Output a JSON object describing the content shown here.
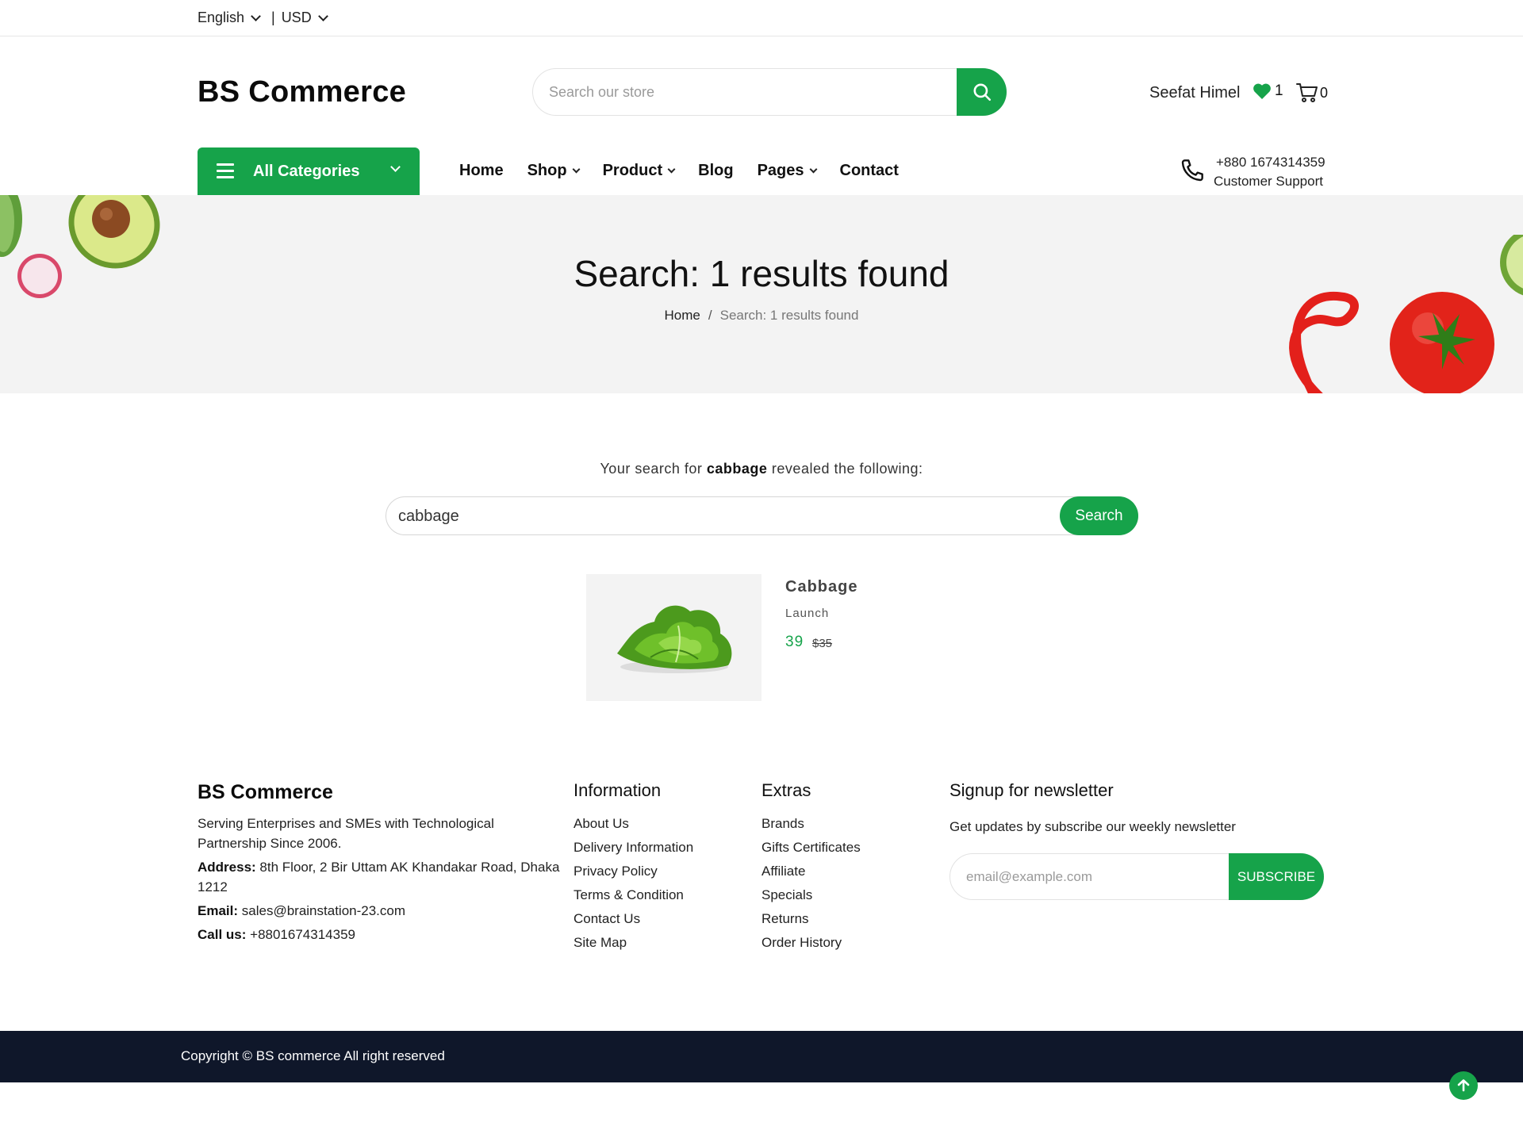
{
  "topbar": {
    "language": "English",
    "currency": "USD",
    "separator": "|"
  },
  "header": {
    "logo": "BS Commerce",
    "search_placeholder": "Search our store",
    "user_name": "Seefat Himel",
    "wishlist_count": "1",
    "cart_count": "0"
  },
  "nav": {
    "all_categories": "All Categories",
    "items": [
      "Home",
      "Shop",
      "Product",
      "Blog",
      "Pages",
      "Contact"
    ],
    "support_phone": "+880 1674314359",
    "support_label": "Customer Support"
  },
  "hero": {
    "title": "Search: 1 results found",
    "breadcrumb_home": "Home",
    "breadcrumb_sep": "/",
    "breadcrumb_current": "Search: 1 results found"
  },
  "results": {
    "reveal_prefix": "Your search for",
    "query": "cabbage",
    "reveal_suffix": "revealed the following:",
    "search_value": "cabbage",
    "search_button": "Search",
    "product": {
      "name": "Cabbage",
      "brand": "Launch",
      "price": "39",
      "old_price": "$35"
    }
  },
  "footer": {
    "logo": "BS Commerce",
    "about": "Serving Enterprises and SMEs with Technological Partnership Since 2006.",
    "address_label": "Address:",
    "address": "8th Floor, 2 Bir Uttam AK Khandakar Road, Dhaka 1212",
    "email_label": "Email:",
    "email": "sales@brainstation-23.com",
    "call_label": "Call us:",
    "call": "+8801674314359",
    "information_title": "Information",
    "information": [
      "About Us",
      "Delivery Information",
      "Privacy Policy",
      "Terms & Condition",
      "Contact Us",
      "Site Map"
    ],
    "extras_title": "Extras",
    "extras": [
      "Brands",
      "Gifts Certificates",
      "Affiliate",
      "Specials",
      "Returns",
      "Order History"
    ],
    "newsletter_title": "Signup for newsletter",
    "newsletter_text": "Get updates by subscribe our weekly newsletter",
    "newsletter_placeholder": "email@example.com",
    "subscribe": "SUBSCRIBE",
    "copyright": "Copyright © BS commerce All right reserved"
  },
  "colors": {
    "accent": "#16a34a",
    "footer_bar": "#0f172a",
    "hero_bg": "#f3f3f3"
  },
  "icons": [
    "chevron-down-icon",
    "search-icon",
    "heart-icon",
    "cart-icon",
    "menu-icon",
    "phone-icon",
    "arrow-up-icon"
  ]
}
